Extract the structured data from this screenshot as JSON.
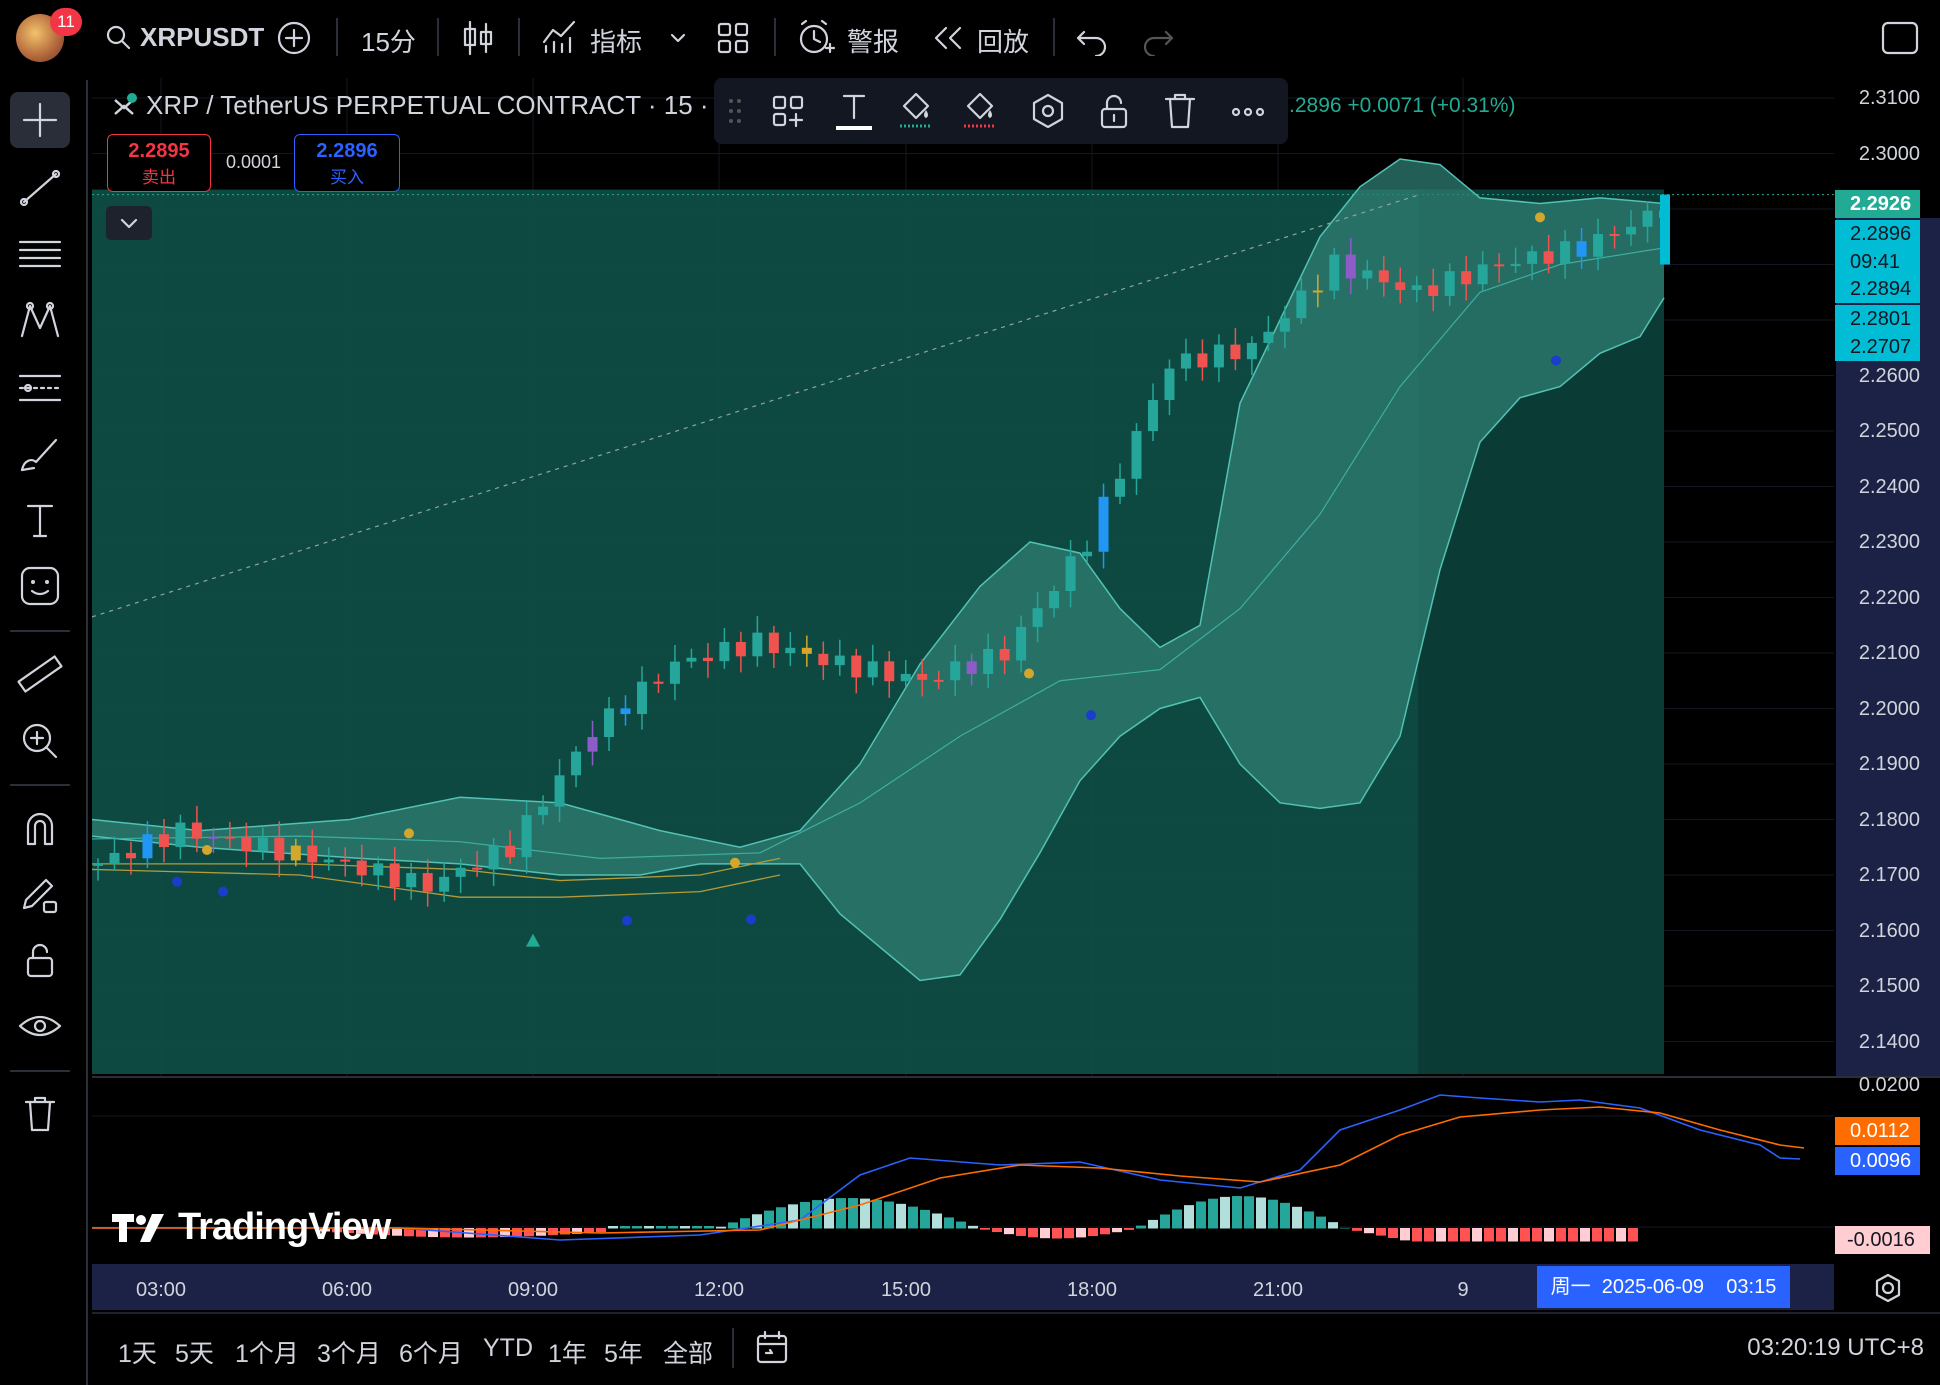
{
  "toolbar": {
    "notification_count": "11",
    "symbol": "XRPUSDT",
    "interval": "15分",
    "indicators_label": "指标",
    "alert_label": "警报",
    "replay_label": "回放"
  },
  "legend": {
    "title": "XRP / TetherUS PERPETUAL CONTRACT · 15 · B",
    "price_change": "2.2896 +0.0071 (+0.31%)",
    "price_change_visible": ".2896 +0.0071 (+0.31%)",
    "sell_price": "2.2895",
    "sell_label": "卖出",
    "spread": "0.0001",
    "buy_price": "2.2896",
    "buy_label": "买入"
  },
  "price_axis": {
    "ticks": [
      "2.3100",
      "2.3000",
      "2.2600",
      "2.2500",
      "2.2400",
      "2.2300",
      "2.2200",
      "2.2100",
      "2.2000",
      "2.1900",
      "2.1800",
      "2.1700",
      "2.1600",
      "2.1500",
      "2.1400"
    ],
    "tags": [
      {
        "value": "2.2926",
        "color": "#22ab94"
      },
      {
        "value": "2.2896",
        "color": "#00bcd4"
      },
      {
        "value": "09:41",
        "color": "#00bcd4"
      },
      {
        "value": "2.2894",
        "color": "#00bcd4"
      },
      {
        "value": "2.2801",
        "color": "#00bcd4"
      },
      {
        "value": "2.2707",
        "color": "#00bcd4"
      }
    ]
  },
  "macd_axis": {
    "top_tick": "0.0200",
    "signal_value": "0.0112",
    "macd_value": "0.0096",
    "hist_value": "-0.0016",
    "signal_color": "#ff6d00",
    "macd_color": "#2962ff",
    "hist_color": "#ffcdd2"
  },
  "time_axis": {
    "labels": [
      "03:00",
      "06:00",
      "09:00",
      "12:00",
      "15:00",
      "18:00",
      "21:00",
      "9"
    ],
    "crosshair": "周一  2025-06-09    03:15"
  },
  "bottom_bar": {
    "ranges": [
      "1天",
      "5天",
      "1个月",
      "3个月",
      "6个月",
      "YTD",
      "1年",
      "5年",
      "全部"
    ],
    "clock": "03:20:19 UTC+8"
  },
  "watermark": "TradingView",
  "colors": {
    "up": "#26a69a",
    "down": "#ef5350",
    "band_fill": "#2f7d73",
    "range_fill": "#0e4d44",
    "axis_bg": "#1b2245"
  },
  "chart_data": {
    "type": "candlestick",
    "symbol": "XRPUSDT",
    "interval": "15",
    "ylim": [
      2.14,
      2.31
    ],
    "x": [
      "03:00",
      "06:00",
      "09:00",
      "12:00",
      "15:00",
      "18:00",
      "21:00",
      "9"
    ],
    "series": [
      {
        "close": [
          2.172,
          2.178,
          2.175,
          2.172,
          2.168,
          2.175,
          2.196,
          2.208,
          2.212,
          2.208,
          2.205,
          2.21,
          2.23,
          2.262,
          2.265,
          2.28,
          2.275,
          2.28,
          2.283,
          2.29
        ]
      }
    ],
    "last_price": 2.2896,
    "indicators": {
      "macd": {
        "macd": 0.0096,
        "signal": 0.0112,
        "histogram": -0.0016
      }
    }
  }
}
